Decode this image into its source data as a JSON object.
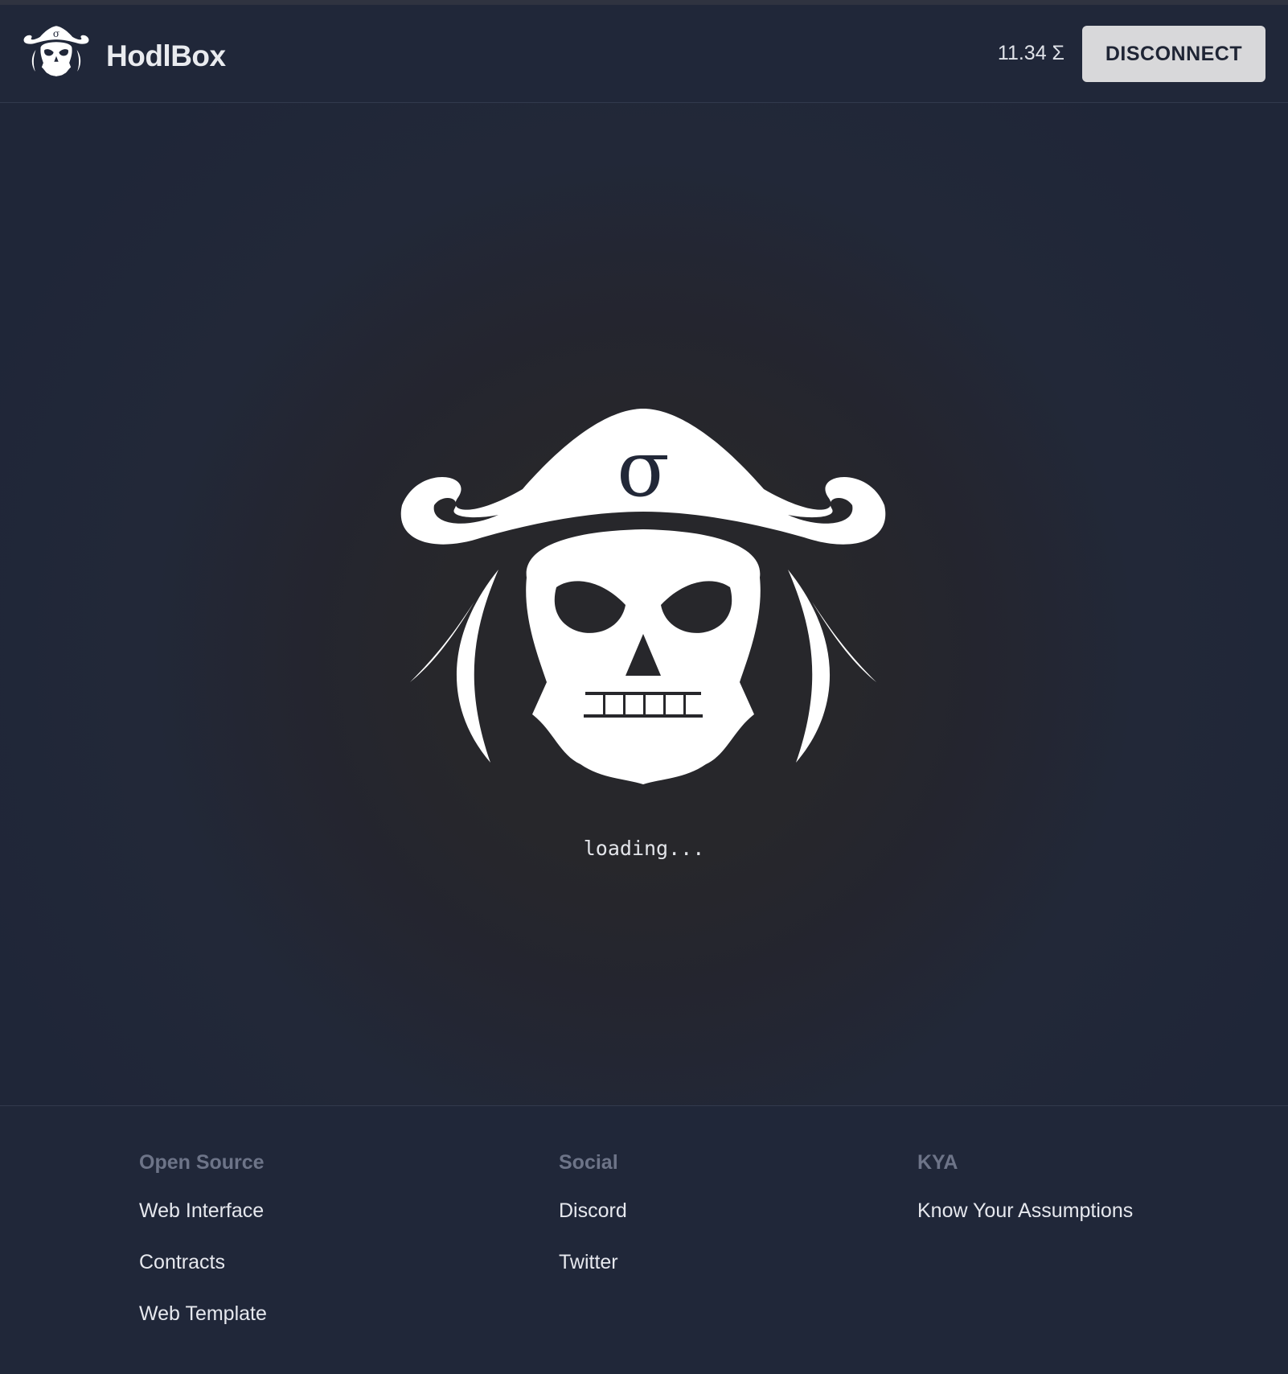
{
  "header": {
    "brand_name": "HodlBox",
    "balance": "11.34 Σ",
    "disconnect_label": "DISCONNECT"
  },
  "main": {
    "loading_text": "loading..."
  },
  "footer": {
    "columns": [
      {
        "heading": "Open Source",
        "links": [
          "Web Interface",
          "Contracts",
          "Web Template"
        ]
      },
      {
        "heading": "Social",
        "links": [
          "Discord",
          "Twitter"
        ]
      },
      {
        "heading": "KYA",
        "links": [
          "Know Your Assumptions"
        ]
      }
    ]
  },
  "icons": {
    "brand_logo": "pirate-skull-icon",
    "hero_logo": "pirate-skull-icon"
  },
  "colors": {
    "background": "#1f2638",
    "header_footer": "#202739",
    "button_bg": "#d8d8da",
    "footer_heading": "#6d7488"
  }
}
